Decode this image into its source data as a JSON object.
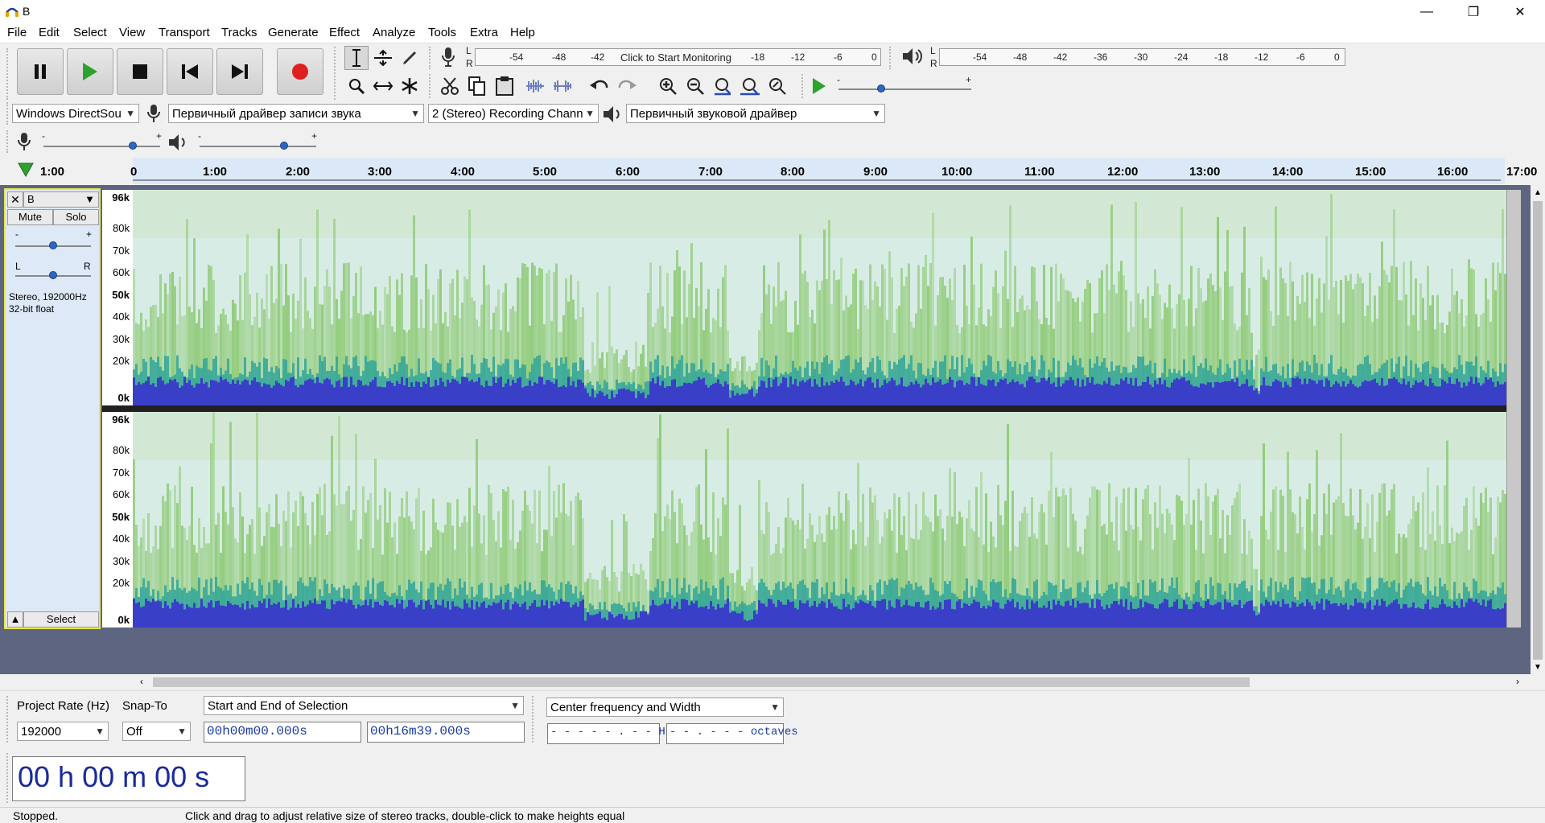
{
  "window": {
    "title": "B",
    "min": "—",
    "max": "❐",
    "close": "✕"
  },
  "menu": [
    "File",
    "Edit",
    "Select",
    "View",
    "Transport",
    "Tracks",
    "Generate",
    "Effect",
    "Analyze",
    "Tools",
    "Extra",
    "Help"
  ],
  "record_meter": {
    "lr": [
      "L",
      "R"
    ],
    "ticks": [
      "-54",
      "-48",
      "-42",
      "-18",
      "-12",
      "-6",
      "0"
    ],
    "hint": "Click to Start Monitoring"
  },
  "play_meter": {
    "lr": [
      "L",
      "R"
    ],
    "ticks": [
      "-54",
      "-48",
      "-42",
      "-36",
      "-30",
      "-24",
      "-18",
      "-12",
      "-6",
      "0"
    ]
  },
  "play_speed": {
    "minus": "-",
    "plus": "+"
  },
  "devices": {
    "host": "Windows DirectSou",
    "recording": "Первичный драйвер записи звука",
    "channels": "2 (Stereo) Recording Chann",
    "playback": "Первичный звуковой драйвер"
  },
  "mixer": {
    "minus": "-",
    "plus": "+"
  },
  "ruler": {
    "left": "1:00",
    "labels": [
      "0",
      "1:00",
      "2:00",
      "3:00",
      "4:00",
      "5:00",
      "6:00",
      "7:00",
      "8:00",
      "9:00",
      "10:00",
      "11:00",
      "12:00",
      "13:00",
      "14:00",
      "15:00",
      "16:00"
    ],
    "right": "17:00"
  },
  "track": {
    "name": "B",
    "mute": "Mute",
    "solo": "Solo",
    "gain_minus": "-",
    "gain_plus": "+",
    "pan_l": "L",
    "pan_r": "R",
    "info_line1": "Stereo, 192000Hz",
    "info_line2": "32-bit float",
    "select": "Select"
  },
  "freq_labels": [
    "96k",
    "80k",
    "70k",
    "60k",
    "50k",
    "40k",
    "30k",
    "20k",
    "0k"
  ],
  "selection": {
    "rate_label": "Project Rate (Hz)",
    "snap_label": "Snap-To",
    "rate_value": "192000",
    "snap_value": "Off",
    "mode": "Start and End of Selection",
    "start": "00h00m00.000s",
    "end": "00h16m39.000s",
    "spectral_mode": "Center frequency and Width",
    "freq": "- - - - - . - - Hz",
    "width": "- - . - - - octaves"
  },
  "audio_position": "00 h 00 m 00 s",
  "status": {
    "state": "Stopped.",
    "hint": "Click and drag to adjust relative size of stereo tracks, double-click to make heights equal"
  },
  "colors": {
    "accent": "#2e66c4",
    "spectrogram_bg": "#d8ece6",
    "track_border": "#e8e84a",
    "record": "#e02020",
    "play": "#2fa12f"
  }
}
